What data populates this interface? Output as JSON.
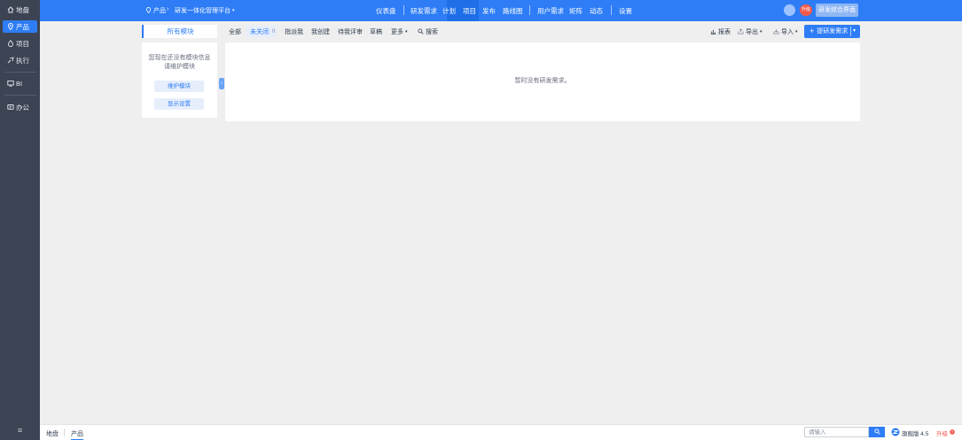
{
  "sidebar": {
    "items": [
      {
        "label": "地盘",
        "icon": "home-icon"
      },
      {
        "label": "产品",
        "icon": "location-pin-icon",
        "active": true
      },
      {
        "label": "项目",
        "icon": "project-icon"
      },
      {
        "label": "执行",
        "icon": "run-icon"
      },
      {
        "label": "BI",
        "icon": "bi-icon"
      },
      {
        "label": "办公",
        "icon": "office-icon"
      }
    ],
    "collapse_icon": "menu-icon"
  },
  "header": {
    "breadcrumb_product": "产品",
    "breadcrumb_current": "研发一体化管理平台",
    "nav": {
      "dashboard": "仪表盘",
      "rd_requirements": "研发需求",
      "plan": "计划",
      "project": "项目",
      "release": "发布",
      "roadmap": "路线图",
      "user_requirements": "用户需求",
      "matrix": "矩阵",
      "dynamics": "动态",
      "settings": "设置"
    },
    "upgrade_badge": "升级",
    "switch_button": "研发综合界面"
  },
  "toolbar": {
    "module_tab": "所有模块",
    "tabs": {
      "all": "全部",
      "unclosed": "未关闭",
      "unclosed_count": "0",
      "assigned_to_me": "指派我",
      "created_by_me": "我创建",
      "pending_review": "待我评审",
      "draft": "草稿",
      "more": "更多"
    },
    "search": "搜索",
    "report": "报表",
    "export": "导出",
    "import": "导入",
    "create_button": "提研发需求"
  },
  "module_panel": {
    "empty_line1": "您现在还没有模块信息",
    "empty_line2": "请维护模块",
    "maintain_button": "维护模块",
    "display_settings_button": "显示设置"
  },
  "content": {
    "empty_message": "暂时没有研发需求。"
  },
  "footer": {
    "crumb_home": "地盘",
    "crumb_product": "产品",
    "search_placeholder": "请输入",
    "version": "旗舰版 4.5",
    "upgrade": "升级"
  },
  "colors": {
    "primary": "#2e7df6",
    "sidebar_bg": "#3c4353",
    "badge_red": "#f35a4b"
  }
}
